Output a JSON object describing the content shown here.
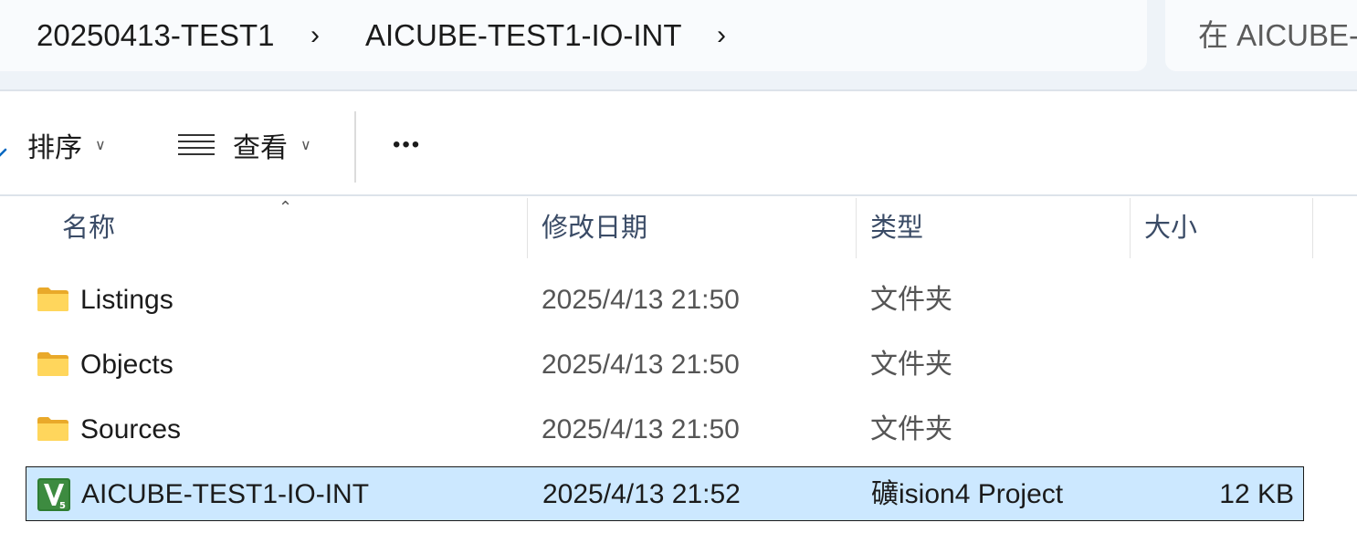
{
  "breadcrumb": {
    "items": [
      "20250413-TEST1",
      "AICUBE-TEST1-IO-INT"
    ]
  },
  "search": {
    "placeholder": "在 AICUBE-"
  },
  "toolbar": {
    "sort_label": "排序",
    "view_label": "查看",
    "more_label": "•••"
  },
  "columns": {
    "name": "名称",
    "date": "修改日期",
    "type": "类型",
    "size": "大小"
  },
  "files": [
    {
      "name": "Listings",
      "date": "2025/4/13 21:50",
      "type": "文件夹",
      "size": "",
      "icon": "folder-icon",
      "selected": false
    },
    {
      "name": "Objects",
      "date": "2025/4/13 21:50",
      "type": "文件夹",
      "size": "",
      "icon": "folder-icon",
      "selected": false
    },
    {
      "name": "Sources",
      "date": "2025/4/13 21:50",
      "type": "文件夹",
      "size": "",
      "icon": "folder-icon",
      "selected": false
    },
    {
      "name": "AICUBE-TEST1-IO-INT",
      "date": "2025/4/13 21:52",
      "type": "礦ision4 Project",
      "size": "12 KB",
      "icon": "uvision-project-icon",
      "selected": true
    }
  ],
  "colors": {
    "selection_bg": "#cce8ff",
    "accent": "#0067c0",
    "folder": "#f7c948"
  }
}
